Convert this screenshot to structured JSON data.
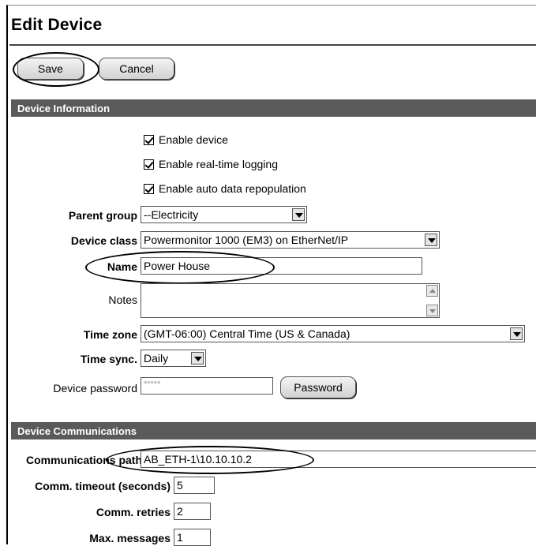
{
  "page": {
    "title": "Edit Device",
    "save_label": "Save",
    "cancel_label": "Cancel"
  },
  "device_information": {
    "header": "Device Information",
    "checkboxes": [
      {
        "label": "Enable device",
        "checked": true
      },
      {
        "label": "Enable real-time logging",
        "checked": true
      },
      {
        "label": "Enable auto data repopulation",
        "checked": true
      }
    ],
    "parent_group": {
      "label": "Parent group",
      "value": "--Electricity"
    },
    "device_class": {
      "label": "Device class",
      "value": "Powermonitor 1000 (EM3) on EtherNet/IP"
    },
    "name": {
      "label": "Name",
      "value": "Power House"
    },
    "notes": {
      "label": "Notes",
      "value": ""
    },
    "time_zone": {
      "label": "Time zone",
      "value": "(GMT-06:00) Central Time (US & Canada)"
    },
    "time_sync": {
      "label": "Time sync.",
      "value": "Daily"
    },
    "device_password": {
      "label": "Device password",
      "value": "*****",
      "button_label": "Password"
    }
  },
  "device_communications": {
    "header": "Device Communications",
    "communications_path": {
      "label": "Communications path",
      "value": "AB_ETH-1\\10.10.10.2"
    },
    "comm_timeout": {
      "label": "Comm. timeout (seconds)",
      "value": "5"
    },
    "comm_retries": {
      "label": "Comm. retries",
      "value": "2"
    },
    "max_messages": {
      "label": "Max. messages",
      "value": "1"
    }
  }
}
